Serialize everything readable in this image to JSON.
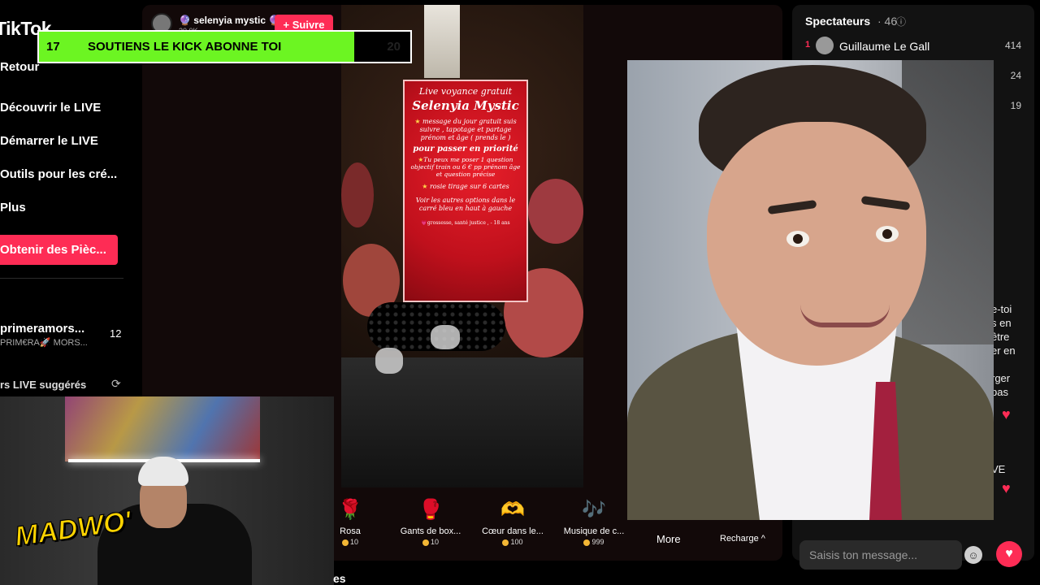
{
  "sidebar": {
    "logo": "TikTok",
    "nav": [
      "Retour",
      "Découvrir le LIVE",
      "Démarrer le LIVE",
      "Outils pour les cré...",
      "Plus"
    ],
    "coins_button": "Obtenir des Pièc...",
    "suggested_account": {
      "name": "primeramors...",
      "sub": "PRIM€RA🚀 MORS...",
      "count": "12"
    },
    "suggested_header": "rs LIVE suggérés"
  },
  "live": {
    "host_name": "🔮 selenyia mystic 🔮",
    "host_sub": "30.0K",
    "follow_label": "+ Suivre"
  },
  "flyer": {
    "line1": "Live voyance gratuit",
    "line2": "Selenyia Mystic",
    "line3": "message du jour gratuit suis suivre , tapotage et partage prénom et âge ( prends le )",
    "line4": "pour passer en priorité",
    "line5": "Tu peux me poser 1 question objectif train ou 6 € pp prénom âge et question précise",
    "line6": "rosie tirage sur 6 cartes",
    "line7": "Voir les autres options dans le carré bleu en haut à gauche",
    "line8": "💗grossesse, santé justice , - 18 ans"
  },
  "banner": {
    "number": "17",
    "text": "SOUTIENS LE KICK ABONNE TOI",
    "right": "20"
  },
  "gifts": [
    {
      "name": "Rosa",
      "price": "10",
      "icon": "🌹"
    },
    {
      "name": "Gants de box...",
      "price": "10",
      "icon": "🥊"
    },
    {
      "name": "Cœur dans le...",
      "price": "100",
      "icon": "🫶"
    },
    {
      "name": "Musique de c...",
      "price": "999",
      "icon": "🎶"
    }
  ],
  "more_label": "More",
  "recharge_label": "Recharge ^",
  "viewers": {
    "title": "Spectateurs",
    "count": "· 46",
    "list": [
      {
        "rank": "1",
        "name": "Guillaume Le Gall",
        "score": "414"
      },
      {
        "rank": "",
        "name": "",
        "score": "24"
      },
      {
        "rank": "",
        "name": "",
        "score": "19"
      }
    ]
  },
  "chat_fragments": [
    "e-toi",
    "s en",
    "être",
    "er en",
    "rger",
    "pas",
    "VE"
  ],
  "chat_input_placeholder": "Saisis ton message...",
  "webcam_logo": "MADWO'",
  "bottom_text": "es"
}
